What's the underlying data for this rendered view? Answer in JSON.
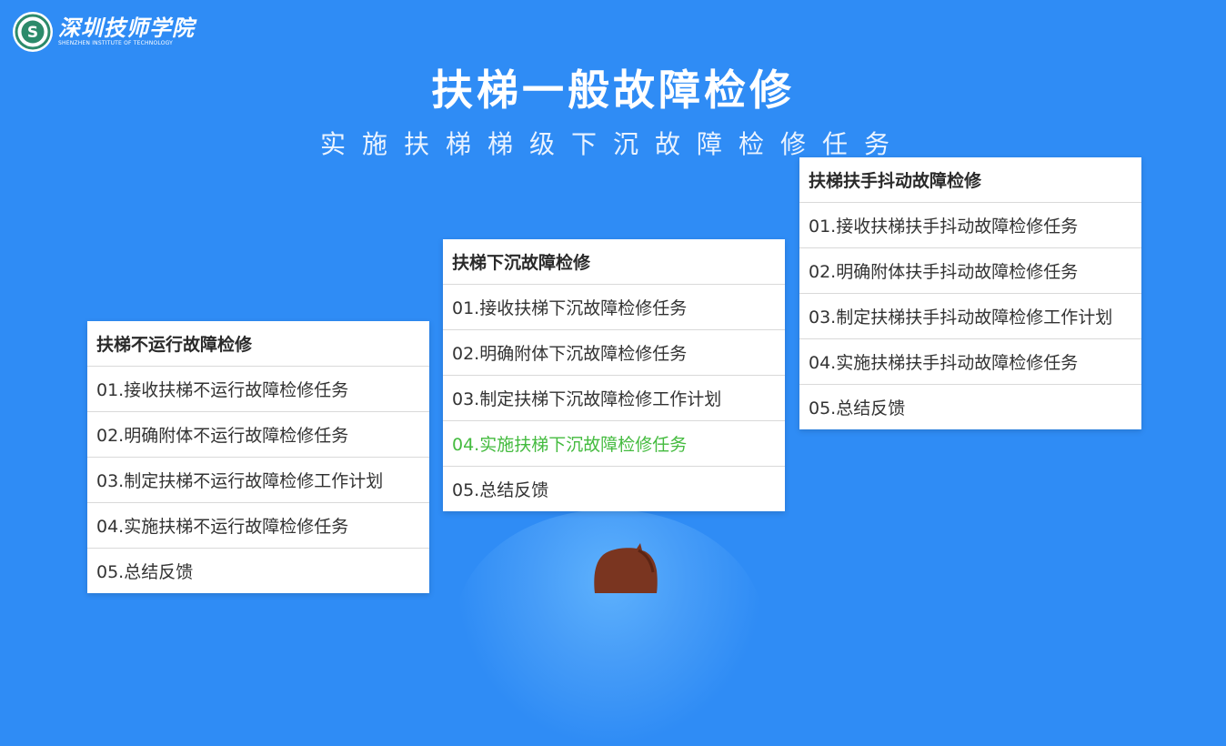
{
  "logo": {
    "name": "深圳技师学院",
    "subtitle": "SHENZHEN INSTITUTE OF TECHNOLOGY",
    "seal_letter": "S"
  },
  "title": "扶梯一般故障检修",
  "subtitle": "实施扶梯梯级下沉故障检修任务",
  "colors": {
    "background": "#2f8cf5",
    "active_item": "#44bb3f",
    "seal": "#2c8a6a"
  },
  "cards": [
    {
      "header": "扶梯不运行故障检修",
      "items": [
        "01.接收扶梯不运行故障检修任务",
        "02.明确附体不运行故障检修任务",
        "03.制定扶梯不运行故障检修工作计划",
        "04.实施扶梯不运行故障检修任务",
        "05.总结反馈"
      ]
    },
    {
      "header": "扶梯下沉故障检修",
      "items": [
        "01.接收扶梯下沉故障检修任务",
        "02.明确附体下沉故障检修任务",
        "03.制定扶梯下沉故障检修工作计划",
        "04.实施扶梯下沉故障检修任务",
        "05.总结反馈"
      ],
      "active_index": 3
    },
    {
      "header": "扶梯扶手抖动故障检修",
      "items": [
        "01.接收扶梯扶手抖动故障检修任务",
        "02.明确附体扶手抖动故障检修任务",
        "03.制定扶梯扶手抖动故障检修工作计划",
        "04.实施扶梯扶手抖动故障检修任务",
        "05.总结反馈"
      ]
    }
  ]
}
